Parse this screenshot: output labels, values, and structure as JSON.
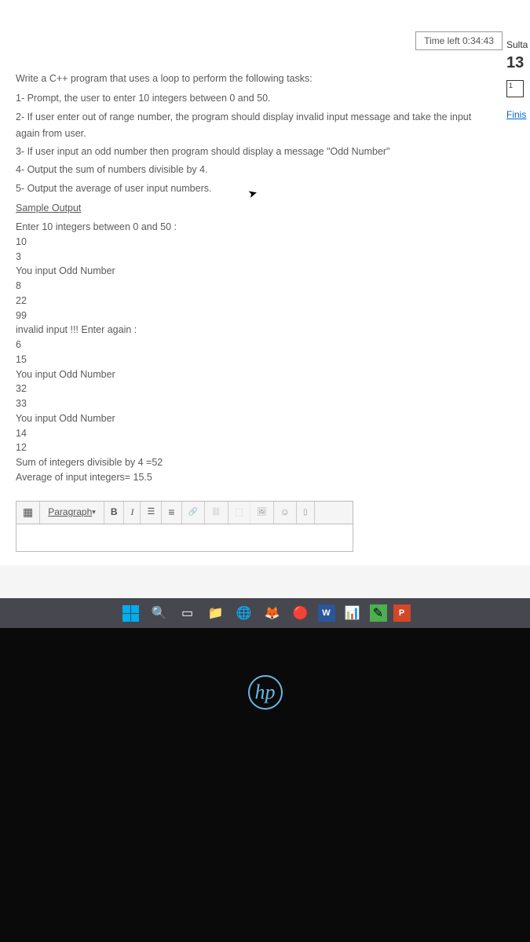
{
  "timer": {
    "label": "Time left 0:34:43"
  },
  "side": {
    "sulta": "Sulta",
    "num": "13",
    "qnum": "1",
    "finis": "Finis"
  },
  "question": {
    "intro": "Write a C++ program that uses a loop to perform the following tasks:",
    "items": [
      "1-   Prompt, the user to enter 10 integers between 0 and 50.",
      "2-   If user enter out of range number, the program should display invalid input message and take the input again from user.",
      "3-   If user input an odd number then program should display a message \"Odd Number\"",
      "4-   Output the sum of numbers divisible by 4.",
      "5-   Output the average of user input numbers."
    ],
    "sample_heading": "Sample Output",
    "output": [
      "Enter 10 integers between 0 and 50 :",
      "10",
      "3",
      "You input Odd Number",
      "8",
      "22",
      "99",
      "invalid input !!! Enter again :",
      "6",
      "15",
      "You input Odd Number",
      "32",
      "33",
      "You input Odd Number",
      "14",
      "12",
      "Sum of integers divisible by 4 =52",
      "Average of input integers= 15.5"
    ]
  },
  "toolbar": {
    "paragraph": "Paragraph",
    "bold": "B",
    "italic": "I"
  },
  "hp": "hp"
}
